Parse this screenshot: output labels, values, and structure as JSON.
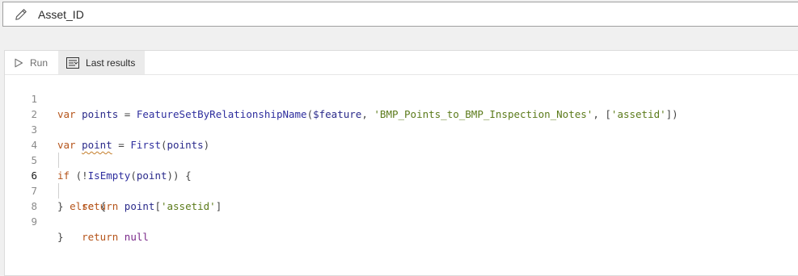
{
  "header": {
    "title": "Asset_ID",
    "icon": "pencil-icon"
  },
  "toolbar": {
    "run_label": "Run",
    "last_results_label": "Last results",
    "run_icon": "play-icon",
    "results_icon": "results-table-icon"
  },
  "editor": {
    "current_line": 6,
    "lines": [
      {
        "number": "1",
        "text": "var points = FeatureSetByRelationshipName($feature, 'BMP_Points_to_BMP_Inspection_Notes', ['assetid'])"
      },
      {
        "number": "2",
        "text": ""
      },
      {
        "number": "3",
        "text": "var point = First(points)"
      },
      {
        "number": "4",
        "text": ""
      },
      {
        "number": "5",
        "text": "if (!IsEmpty(point)) {"
      },
      {
        "number": "6",
        "text": "    return point['assetid']"
      },
      {
        "number": "7",
        "text": "} else {"
      },
      {
        "number": "8",
        "text": "    return null"
      },
      {
        "number": "9",
        "text": "}"
      }
    ]
  },
  "colors": {
    "keyword": "#b5541a",
    "function": "#2e2e9e",
    "string": "#5b7a1a",
    "null": "#7a2a8a",
    "warning_underline": "#c47e2a"
  }
}
